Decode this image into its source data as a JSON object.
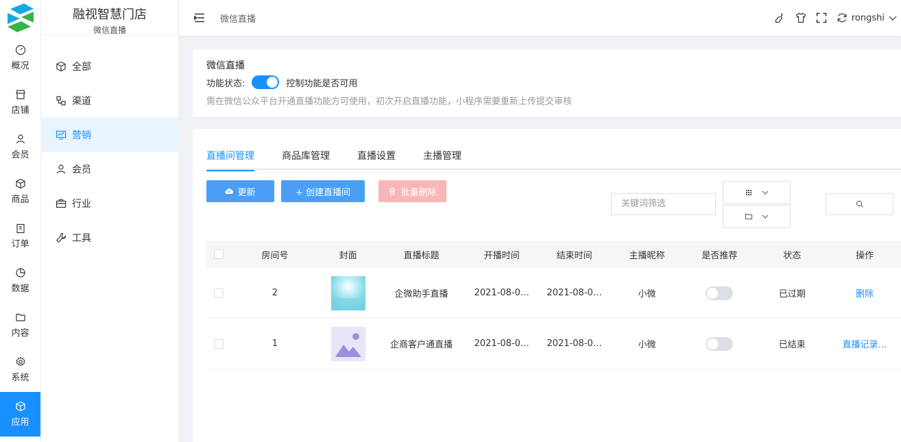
{
  "app": {
    "name": "融视智慧门店",
    "subtitle": "微信直播"
  },
  "rail": [
    {
      "label": "概况",
      "icon": "dashboard-icon"
    },
    {
      "label": "店铺",
      "icon": "shop-icon"
    },
    {
      "label": "会员",
      "icon": "user-icon"
    },
    {
      "label": "商品",
      "icon": "cube-icon"
    },
    {
      "label": "订单",
      "icon": "clipboard-icon"
    },
    {
      "label": "数据",
      "icon": "chart-pie-icon"
    },
    {
      "label": "内容",
      "icon": "folder-icon"
    },
    {
      "label": "系统",
      "icon": "gear-icon"
    },
    {
      "label": "应用",
      "icon": "cube-icon",
      "active": true
    }
  ],
  "submenu": [
    {
      "label": "全部",
      "icon": "cube-icon"
    },
    {
      "label": "渠道",
      "icon": "channel-icon"
    },
    {
      "label": "营销",
      "icon": "monitor-chart-icon",
      "active": true
    },
    {
      "label": "会员",
      "icon": "user-icon"
    },
    {
      "label": "行业",
      "icon": "briefcase-icon"
    },
    {
      "label": "工具",
      "icon": "wrench-icon"
    }
  ],
  "header": {
    "breadcrumb": "微信直播",
    "user": "rongshi"
  },
  "feature": {
    "title": "微信直播",
    "status_label": "功能状态:",
    "toggle_desc": "控制功能是否可用",
    "note": "需在微信公众平台开通直播功能方可使用，初次开启直播功能，小程序需要重新上传提交审核"
  },
  "tabs": [
    "直播间管理",
    "商品库管理",
    "直播设置",
    "主播管理"
  ],
  "toolbar": {
    "refresh": "更新",
    "create": "+ 创建直播间",
    "batch_delete": "批量删除",
    "keyword_placeholder": "关键词筛选"
  },
  "table": {
    "headers": [
      "房间号",
      "封面",
      "直播标题",
      "开播时间",
      "结束时间",
      "主播昵称",
      "是否推荐",
      "状态",
      "操作"
    ],
    "rows": [
      {
        "room": "2",
        "title": "企微助手直播",
        "start": "2021-08-0…",
        "end": "2021-08-0…",
        "anchor": "小微",
        "status": "已过期",
        "action": "删除"
      },
      {
        "room": "1",
        "title": "企商客户通直播",
        "start": "2021-08-0…",
        "end": "2021-08-0…",
        "anchor": "小微",
        "status": "已结束",
        "action": "直播记录…"
      }
    ]
  },
  "colors": {
    "primary": "#1890ff",
    "danger_light": "#f9b6b6"
  }
}
